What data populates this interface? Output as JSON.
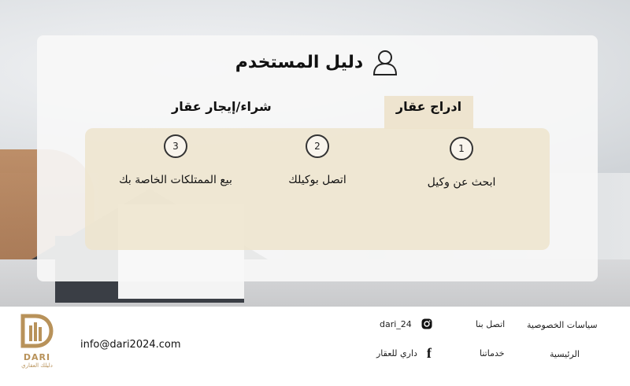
{
  "guide": {
    "title": "دليل المستخدم",
    "tab_list": "ادراج عقار",
    "tab_buy": "شراء/إيجار عقار",
    "steps": [
      {
        "num": "1",
        "label": "ابحث عن وكيل"
      },
      {
        "num": "2",
        "label": "اتصل بوكيلك"
      },
      {
        "num": "3",
        "label": "بيع الممتلكات الخاصة بك"
      }
    ]
  },
  "footer": {
    "logo_text": "DARI",
    "logo_tagline": "دليلك العقاري",
    "email": "info@dari2024.com",
    "instagram": "dari_24",
    "facebook": "داري للعقار",
    "links": {
      "contact": "اتصل بنا",
      "privacy": "سياسات الخصوصية",
      "services": "خدماتنا",
      "home": "الرئيسية"
    }
  },
  "colors": {
    "brand_gold": "#b8925a",
    "panel_beige": "#eee4cb"
  }
}
